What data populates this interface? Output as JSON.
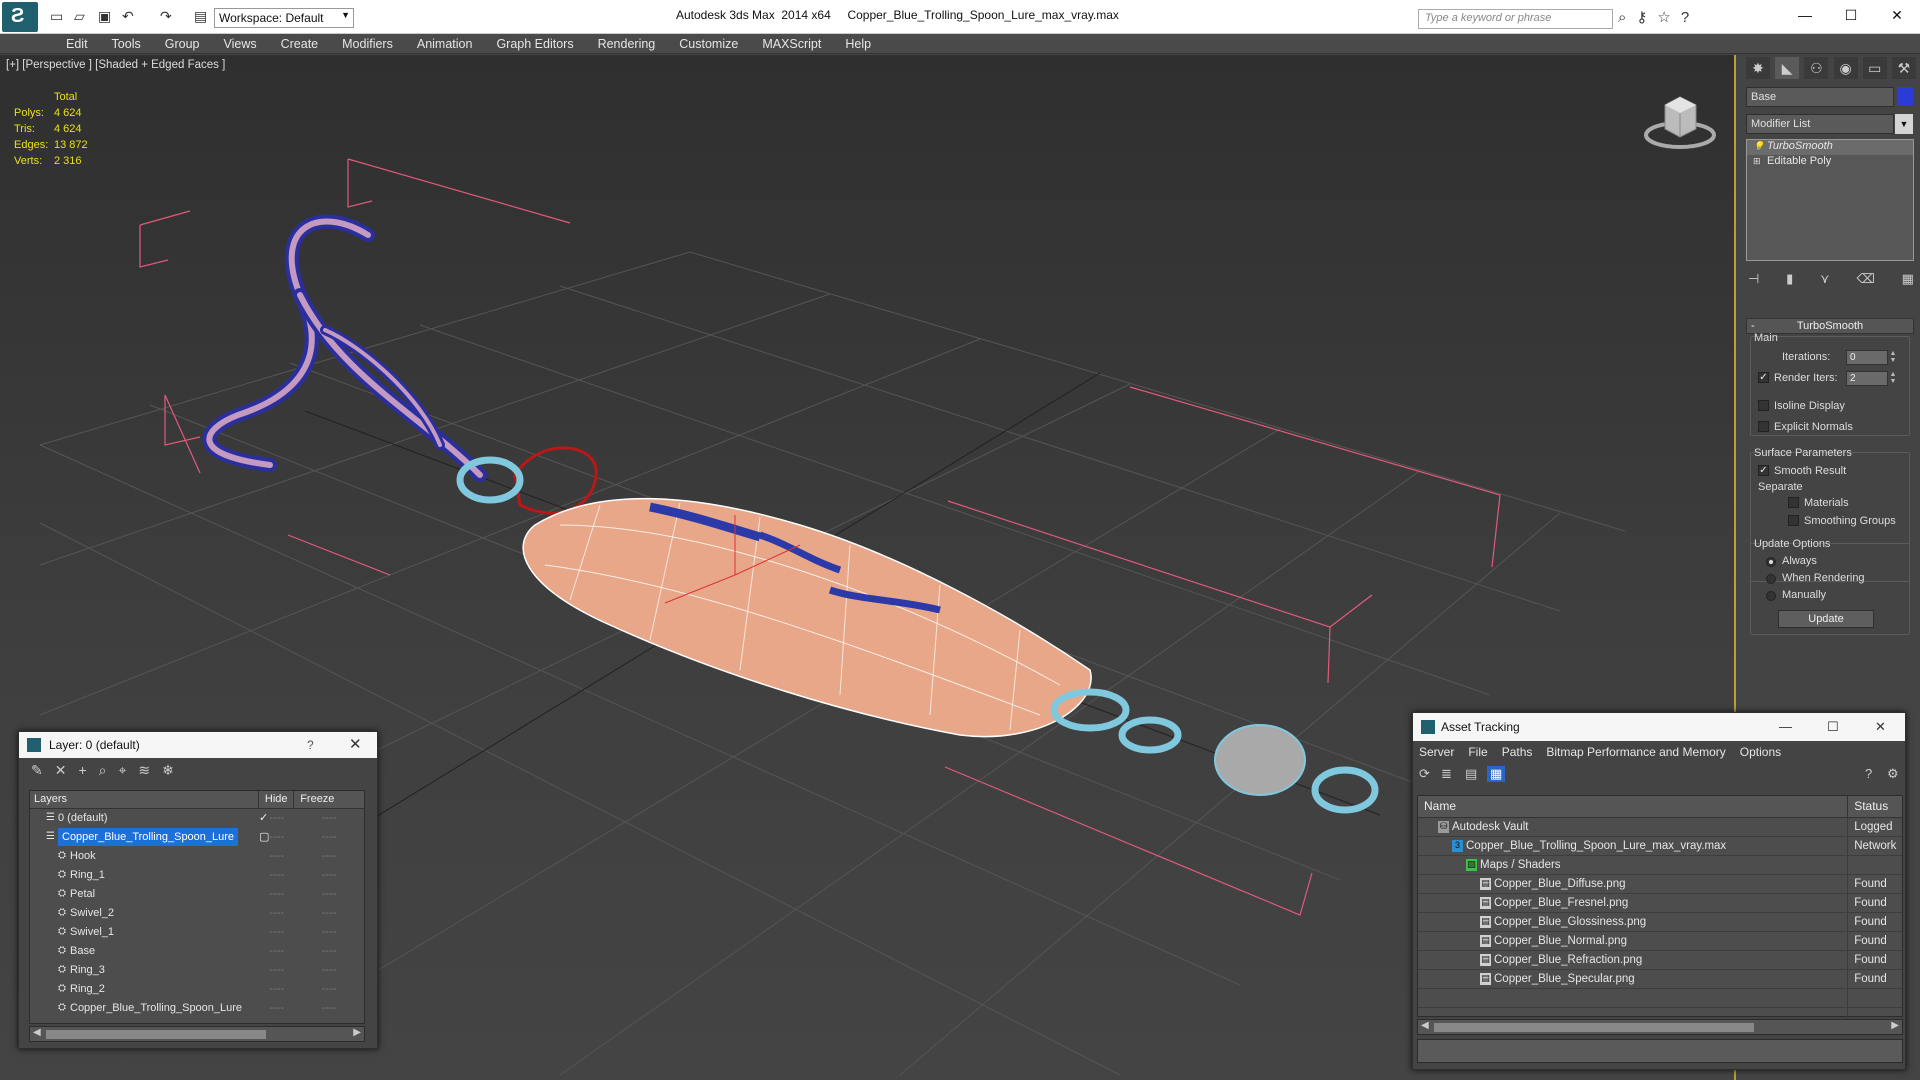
{
  "app": {
    "title": "Autodesk 3ds Max  2014 x64",
    "filename": "Copper_Blue_Trolling_Spoon_Lure_max_vray.max",
    "workspace": "Workspace: Default",
    "search_placeholder": "Type a keyword or phrase"
  },
  "menu": [
    "Edit",
    "Tools",
    "Group",
    "Views",
    "Create",
    "Modifiers",
    "Animation",
    "Graph Editors",
    "Rendering",
    "Customize",
    "MAXScript",
    "Help"
  ],
  "viewport": {
    "label": "[+] [Perspective ] [Shaded + Edged Faces ]",
    "stats_header": "Total",
    "stats": [
      {
        "k": "Polys:",
        "v": "4 624"
      },
      {
        "k": "Tris:",
        "v": "4 624"
      },
      {
        "k": "Edges:",
        "v": "13 872"
      },
      {
        "k": "Verts:",
        "v": "2 316"
      }
    ]
  },
  "command_panel": {
    "object_name": "Base",
    "modifier_list": "Modifier List",
    "stack": [
      "TurboSmooth",
      "Editable Poly"
    ],
    "rollout_title": "TurboSmooth",
    "main_label": "Main",
    "iterations_label": "Iterations:",
    "iterations_value": "0",
    "render_iters_label": "Render Iters:",
    "render_iters_value": "2",
    "isoline_label": "Isoline Display",
    "explicit_normals_label": "Explicit Normals",
    "surface_params_label": "Surface Parameters",
    "smooth_result_label": "Smooth Result",
    "separate_label": "Separate",
    "materials_label": "Materials",
    "smoothing_groups_label": "Smoothing Groups",
    "update_options_label": "Update Options",
    "always_label": "Always",
    "when_rendering_label": "When Rendering",
    "manually_label": "Manually",
    "update_button": "Update",
    "swatch_color": "#2a3bd8"
  },
  "layer_window": {
    "title": "Layer: 0 (default)",
    "help": "?",
    "col_layers": "Layers",
    "col_hide": "Hide",
    "col_freeze": "Freeze",
    "rows": [
      {
        "name": "0 (default)",
        "level": 1,
        "check": "✓"
      },
      {
        "name": "Copper_Blue_Trolling_Spoon_Lure",
        "level": 1,
        "selected": true
      },
      {
        "name": "Hook",
        "level": 2
      },
      {
        "name": "Ring_1",
        "level": 2
      },
      {
        "name": "Petal",
        "level": 2
      },
      {
        "name": "Swivel_2",
        "level": 2
      },
      {
        "name": "Swivel_1",
        "level": 2
      },
      {
        "name": "Base",
        "level": 2
      },
      {
        "name": "Ring_3",
        "level": 2
      },
      {
        "name": "Ring_2",
        "level": 2
      },
      {
        "name": "Copper_Blue_Trolling_Spoon_Lure",
        "level": 2
      }
    ],
    "dash": "----"
  },
  "asset_window": {
    "title": "Asset Tracking",
    "menu": [
      "Server",
      "File",
      "Paths",
      "Bitmap Performance and Memory",
      "Options"
    ],
    "col_name": "Name",
    "col_status": "Status",
    "rows": [
      {
        "name": "Autodesk Vault",
        "status": "Logged",
        "level": 0
      },
      {
        "name": "Copper_Blue_Trolling_Spoon_Lure_max_vray.max",
        "status": "Network",
        "level": 1
      },
      {
        "name": "Maps / Shaders",
        "status": "",
        "level": 2
      },
      {
        "name": "Copper_Blue_Diffuse.png",
        "status": "Found",
        "level": 3
      },
      {
        "name": "Copper_Blue_Fresnel.png",
        "status": "Found",
        "level": 3
      },
      {
        "name": "Copper_Blue_Glossiness.png",
        "status": "Found",
        "level": 3
      },
      {
        "name": "Copper_Blue_Normal.png",
        "status": "Found",
        "level": 3
      },
      {
        "name": "Copper_Blue_Refraction.png",
        "status": "Found",
        "level": 3
      },
      {
        "name": "Copper_Blue_Specular.png",
        "status": "Found",
        "level": 3
      }
    ]
  }
}
